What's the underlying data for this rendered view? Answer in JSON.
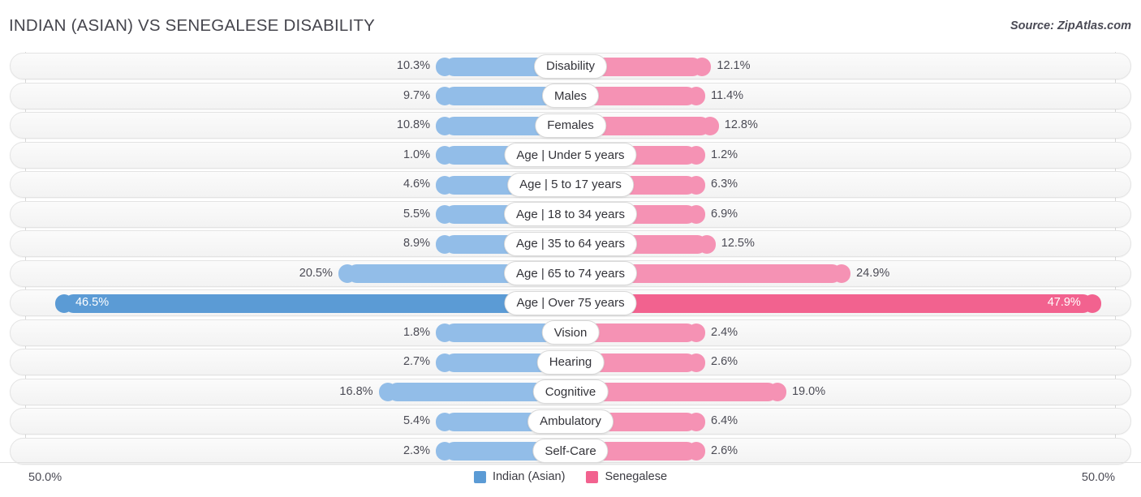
{
  "header": {
    "title": "INDIAN (ASIAN) VS SENEGALESE DISABILITY",
    "source": "Source: ZipAtlas.com"
  },
  "axis": {
    "left_max": "50.0%",
    "right_max": "50.0%"
  },
  "legend": {
    "items": [
      {
        "label": "Indian (Asian)",
        "color": "#5b9bd5",
        "icon": "legend-swatch"
      },
      {
        "label": "Senegalese",
        "color": "#f2628f",
        "icon": "legend-swatch"
      }
    ]
  },
  "colors": {
    "left_bar": "#92bde8",
    "right_bar": "#f592b4",
    "left_bar_highlight": "#5b9bd5",
    "right_bar_highlight": "#f2628f",
    "track": "#f5f5f5",
    "gridline": "#d8d8d8"
  },
  "chart_data": {
    "type": "bar",
    "orientation": "horizontal-diverging",
    "title": "INDIAN (ASIAN) VS SENEGALESE DISABILITY",
    "xlabel": "",
    "ylabel": "",
    "xlim": [
      50.0,
      50.0
    ],
    "axis_max_percent": 50.0,
    "grid": true,
    "legend_position": "bottom-center",
    "categories": [
      "Disability",
      "Males",
      "Females",
      "Age | Under 5 years",
      "Age | 5 to 17 years",
      "Age | 18 to 34 years",
      "Age | 35 to 64 years",
      "Age | 65 to 74 years",
      "Age | Over 75 years",
      "Vision",
      "Hearing",
      "Cognitive",
      "Ambulatory",
      "Self-Care"
    ],
    "series": [
      {
        "name": "Indian (Asian)",
        "color": "#92bde8",
        "values": [
          10.3,
          9.7,
          10.8,
          1.0,
          4.6,
          5.5,
          8.9,
          20.5,
          46.5,
          1.8,
          2.7,
          16.8,
          5.4,
          2.3
        ],
        "labels": [
          "10.3%",
          "9.7%",
          "10.8%",
          "1.0%",
          "4.6%",
          "5.5%",
          "8.9%",
          "20.5%",
          "46.5%",
          "1.8%",
          "2.7%",
          "16.8%",
          "5.4%",
          "2.3%"
        ]
      },
      {
        "name": "Senegalese",
        "color": "#f592b4",
        "values": [
          12.1,
          11.4,
          12.8,
          1.2,
          6.3,
          6.9,
          12.5,
          24.9,
          47.9,
          2.4,
          2.6,
          19.0,
          6.4,
          2.6
        ],
        "labels": [
          "12.1%",
          "11.4%",
          "12.8%",
          "1.2%",
          "6.3%",
          "6.9%",
          "12.5%",
          "24.9%",
          "47.9%",
          "2.4%",
          "2.6%",
          "19.0%",
          "6.4%",
          "2.6%"
        ]
      }
    ],
    "highlighted_rows": [
      "Age | Over 75 years"
    ]
  }
}
